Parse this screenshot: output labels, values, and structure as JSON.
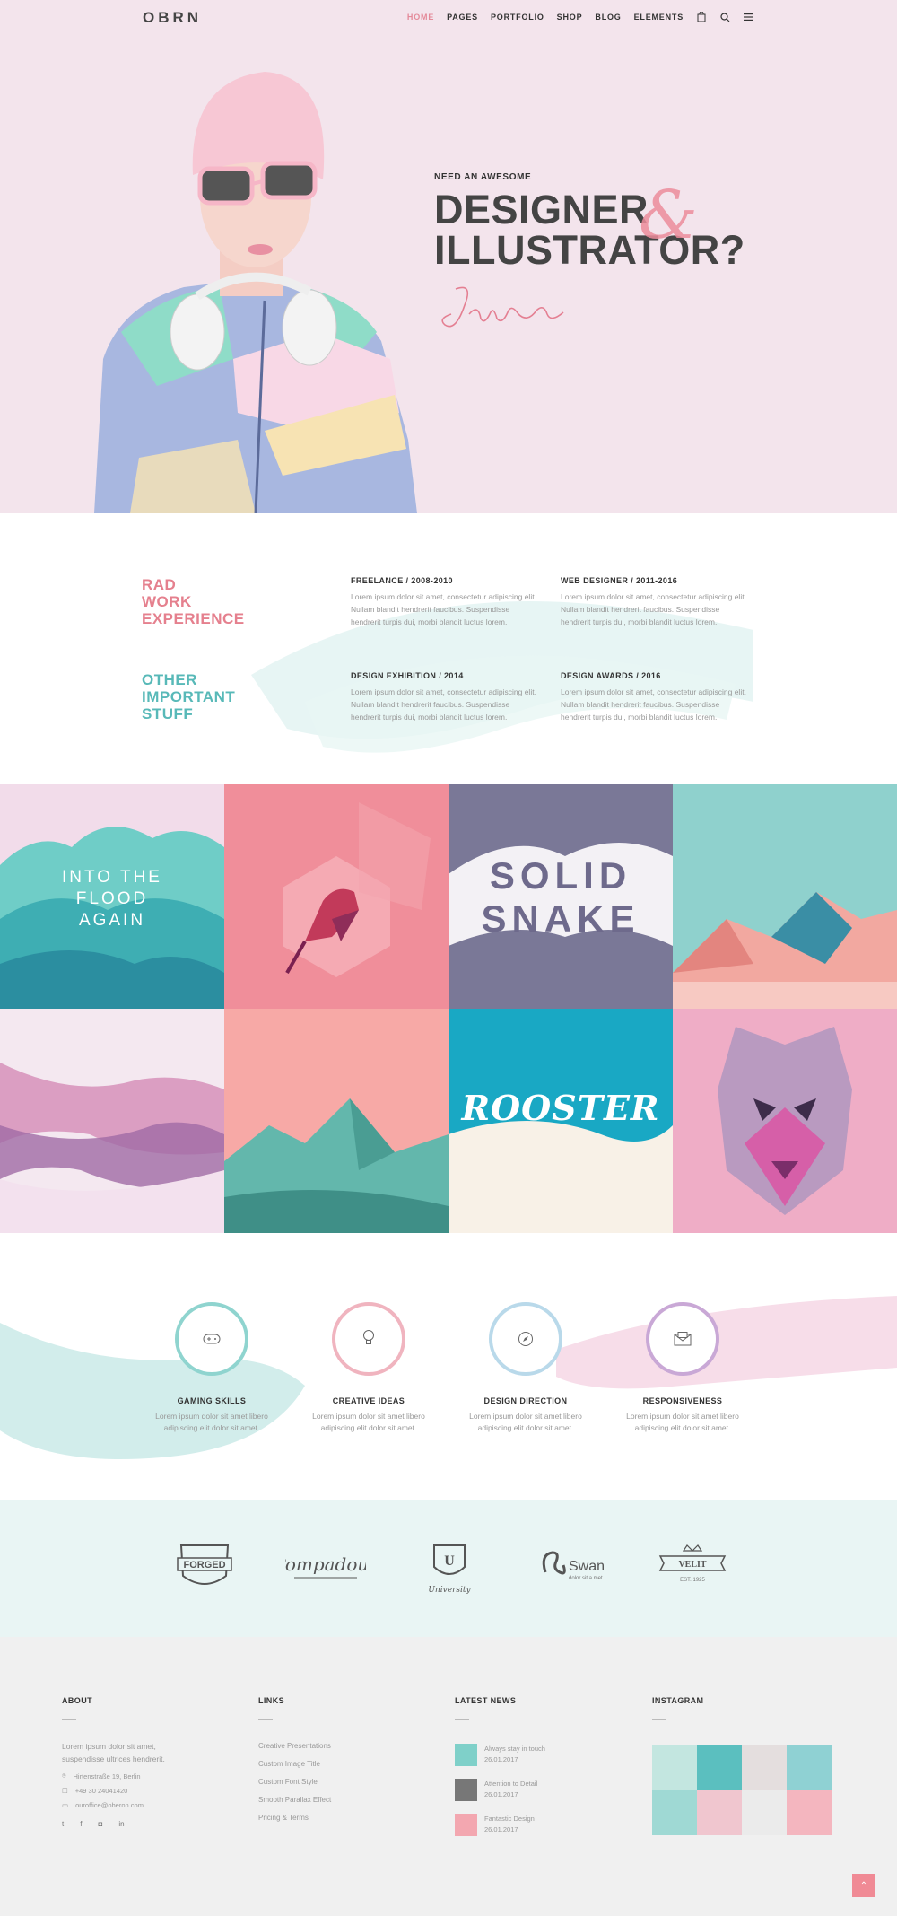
{
  "header": {
    "logo": "OBRN",
    "nav": [
      {
        "label": "HOME",
        "active": true
      },
      {
        "label": "PAGES"
      },
      {
        "label": "PORTFOLIO"
      },
      {
        "label": "SHOP"
      },
      {
        "label": "BLOG"
      },
      {
        "label": "ELEMENTS"
      }
    ],
    "icons": [
      "cart-icon",
      "search-icon",
      "menu-icon"
    ]
  },
  "hero": {
    "eyebrow": "NEED AN AWESOME",
    "line1": "DESIGNER",
    "line2": "ILLUSTRATOR?",
    "ampersand": "&",
    "signature": "JaneDoe"
  },
  "experience": {
    "rad_title": "RAD\nWORK\nEXPERIENCE",
    "other_title": "OTHER\nIMPORTANT\nSTUFF",
    "items": [
      {
        "title": "FREELANCE / 2008-2010",
        "text": "Lorem ipsum dolor sit amet, consectetur adipiscing elit. Nullam blandit hendrerit faucibus. Suspendisse hendrerit turpis dui, morbi blandit luctus lorem."
      },
      {
        "title": "WEB DESIGNER / 2011-2016",
        "text": "Lorem ipsum dolor sit amet, consectetur adipiscing elit. Nullam blandit hendrerit faucibus. Suspendisse hendrerit turpis dui, morbi blandit luctus lorem."
      },
      {
        "title": "DESIGN EXHIBITION / 2014",
        "text": "Lorem ipsum dolor sit amet, consectetur adipiscing elit. Nullam blandit hendrerit faucibus. Suspendisse hendrerit turpis dui, morbi blandit luctus lorem."
      },
      {
        "title": "DESIGN AWARDS / 2016",
        "text": "Lorem ipsum dolor sit amet, consectetur adipiscing elit. Nullam blandit hendrerit faucibus. Suspendisse hendrerit turpis dui, morbi blandit luctus lorem."
      }
    ]
  },
  "portfolio": {
    "tiles": [
      {
        "text": "INTO THE\nFLOOD\nAGAIN",
        "bg": "#4fc0bd"
      },
      {
        "text": "",
        "bg": "#f08e9a"
      },
      {
        "text": "SOLID\nSNAKE",
        "bg": "#7a7897"
      },
      {
        "text": "",
        "bg": "#8fd1cd"
      },
      {
        "text": "",
        "bg": "#f4e8f0"
      },
      {
        "text": "",
        "bg": "#f7a9a6"
      },
      {
        "text": "ROOSTER",
        "bg": "#19a8c4"
      },
      {
        "text": "",
        "bg": "#efadc6"
      }
    ]
  },
  "services": [
    {
      "title": "GAMING SKILLS",
      "text": "Lorem ipsum dolor sit amet libero\nadipiscing elit dolor sit amet.",
      "icon": "gamepad-icon",
      "color": "#8fd4cf"
    },
    {
      "title": "CREATIVE IDEAS",
      "text": "Lorem ipsum dolor sit amet libero\nadipiscing elit dolor sit amet.",
      "icon": "lightbulb-icon",
      "color": "#f0b4bf"
    },
    {
      "title": "DESIGN DIRECTION",
      "text": "Lorem ipsum dolor sit amet libero\nadipiscing elit dolor sit amet.",
      "icon": "compass-icon",
      "color": "#b9d9ea"
    },
    {
      "title": "RESPONSIVENESS",
      "text": "Lorem ipsum dolor sit amet libero\nadipiscing elit dolor sit amet.",
      "icon": "envelope-icon",
      "color": "#c9a8d6"
    }
  ],
  "clients": {
    "forged": {
      "main": "FORGED"
    },
    "pompadour": {
      "main": "Pompadour"
    },
    "university": {
      "letter": "U",
      "main": "University"
    },
    "swan": {
      "main": "Swan",
      "sub": "dolor sit a met"
    },
    "velit": {
      "main": "VELIT",
      "sub": "EST. 1925"
    }
  },
  "footer": {
    "about": {
      "title": "ABOUT",
      "text": "Lorem ipsum dolor sit amet,\nsuspendisse ultrices hendrerit.",
      "address": "Hirtenstraße 19, Berlin",
      "phone": "+49 30 24041420",
      "email": "ouroffice@oberon.com"
    },
    "links": {
      "title": "LINKS",
      "items": [
        "Creative Presentations",
        "Custom Image Title",
        "Custom Font Style",
        "Smooth Parallax Effect",
        "Pricing & Terms"
      ]
    },
    "news": {
      "title": "LATEST NEWS",
      "items": [
        {
          "title": "Always stay in touch",
          "date": "26.01.2017",
          "color": "#7fd0c9"
        },
        {
          "title": "Attention to Detail",
          "date": "26.01.2017",
          "color": "#777777"
        },
        {
          "title": "Fantastic Design",
          "date": "26.01.2017",
          "color": "#f3a7b0"
        }
      ]
    },
    "instagram": {
      "title": "INSTAGRAM",
      "colors": [
        "#c3e6e0",
        "#5bbfbf",
        "#e4dede",
        "#8fd1d3",
        "#9fd9d4",
        "#f0c6cf",
        "#ebebeb",
        "#f4b6bf"
      ]
    },
    "social": [
      "t",
      "f",
      "◘",
      "in"
    ]
  }
}
